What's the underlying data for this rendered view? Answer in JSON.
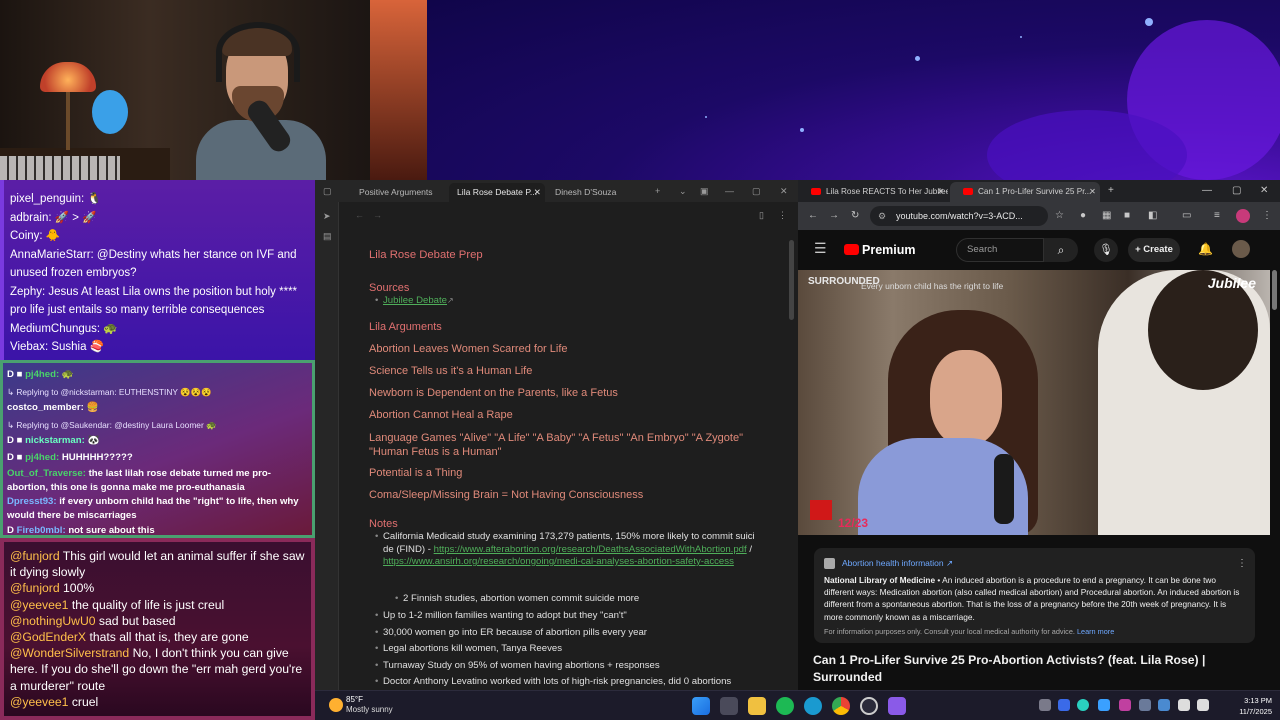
{
  "chat_top": {
    "messages": [
      "pixel_penguin: 🐧",
      "adbrain: 🚀 > 🚀",
      "Coiny: 🐥",
      "AnnaMarieStarr: @Destiny whats her stance on IVF and unused frozen embryos?",
      "Zephy: Jesus At least Lila owns the position but holy **** pro life just entails so many terrible consequences",
      "MediumChungus: 🐢",
      "Viebax: Sushia 🍣"
    ]
  },
  "chat_mid": {
    "messages": [
      {
        "user": "pj4hed:",
        "text": " 🐢",
        "kind": "sub",
        "badge": "D ■"
      },
      {
        "text": "↳ Replying to @nickstarman: EUTHENSTINY 😵😵😵",
        "kind": "reply"
      },
      {
        "user": "costco_member:",
        "text": " 🍔",
        "kind": "plain"
      },
      {
        "text": "↳ Replying to @Saukendar: @destiny Laura Loomer 🐢",
        "kind": "reply"
      },
      {
        "user": "nickstarman:",
        "text": " 🐼",
        "kind": "u2",
        "badge": "D ■"
      },
      {
        "user": "pj4hed:",
        "text": " HUHHHH?????",
        "kind": "sub",
        "badge": "D ■"
      },
      {
        "user": "Out_of_Traverse:",
        "text": " the last lilah rose debate turned me pro-abortion, this one is gonna make me pro-euthanasia",
        "kind": "wrap"
      },
      {
        "user": "Dpresst93:",
        "text": " if every unborn child had the \"right\" to life, then why would there be miscarriages",
        "kind": "wrap"
      },
      {
        "user": "Fireb0mbl:",
        "text": " not sure about this",
        "kind": "u2",
        "badge": "D"
      }
    ]
  },
  "chat_bottom": {
    "messages": [
      {
        "user": "@funjord",
        "text": " This girl would let an animal suffer if she saw it dying slowly"
      },
      {
        "user": "@funjord",
        "text": " 100%"
      },
      {
        "user": "@yeevee1",
        "text": " the quality of life is just creul"
      },
      {
        "user": "@nothingUwU0",
        "text": " sad but based"
      },
      {
        "user": "@GodEnderX",
        "text": " thats all that is, they are gone"
      },
      {
        "user": "@WonderSilverstrand",
        "text": " No, I don't think you can give here. If you do she'll go down the \"err mah gerd you're a murderer\" route"
      },
      {
        "user": "@yeevee1",
        "text": " cruel"
      }
    ]
  },
  "obsidian": {
    "tabs": [
      "Positive Arguments",
      "Lila Rose Debate P...",
      "Dinesh D'Souza"
    ],
    "title": "Lila Rose Debate Prep",
    "sources_heading": "Sources",
    "sources_link": "Jubilee Debate",
    "args_heading": "Lila Arguments",
    "args": [
      "Abortion Leaves Women Scarred for Life",
      "Science Tells us it's a Human Life",
      "Newborn is Dependent on the Parents, like a Fetus",
      "Abortion Cannot Heal a Rape",
      "Language Games \"Alive\" \"A Life\" \"A Baby\" \"A Fetus\" \"An Embryo\" \"A Zygote\" \"Human Fetus is a Human\"",
      "Potential is a Thing",
      "Coma/Sleep/Missing Brain = Not Having Consciousness"
    ],
    "notes_heading": "Notes",
    "note1_text": "California Medicaid study examining 173,279 patients, 150% more likely to commit suicide (FIND) - ",
    "note1_link1": "https://www.afterabortion.org/research/DeathsAssociatedWithAbortion.pdf",
    "note1_sep": " / ",
    "note1_link2": "https://www.ansirh.org/research/ongoing/medi-cal-analyses-abortion-safety-access",
    "note1_sub": "2 Finnish studies, abortion women commit suicide more",
    "notes": [
      "Up to 1-2 million families wanting to adopt but they \"can't\"",
      "30,000 women go into ER because of abortion pills every year",
      "Legal abortions kill women, Tanya Reeves",
      "Turnaway Study on 95% of women having abortions + responses",
      "Doctor Anthony Levatino worked with lots of high-risk pregnancies, did 0 abortions"
    ]
  },
  "browser": {
    "tabs": [
      "Lila Rose REACTS To Her Jubilee",
      "Can 1 Pro-Lifer Survive 25 Pr..."
    ],
    "url": "youtube.com/watch?v=3-ACD...",
    "premium": "Premium",
    "search_placeholder": "Search",
    "create": "Create",
    "video_brand": "SURROUNDED",
    "video_tagline": "Every unborn child has the right to life",
    "video_watermark": "Jubilee",
    "video_count": "12/23",
    "info_heading": "Abortion health information ↗",
    "info_source": "National Library of Medicine",
    "info_body": " • An induced abortion is a procedure to end a pregnancy. It can be done two different ways: Medication abortion (also called medical abortion) and Procedural abortion. An induced abortion is different from a spontaneous abortion. That is the loss of a pregnancy before the 20th week of pregnancy. It is more commonly known as a miscarriage.",
    "info_note": "For information purposes only. Consult your local medical authority for advice. ",
    "info_more": "Learn more",
    "video_title": "Can 1 Pro-Lifer Survive 25 Pro-Abortion Activists? (feat. Lila Rose) | Surrounded"
  },
  "taskbar": {
    "temp": "85°F",
    "condition": "Mostly sunny",
    "time": "3:13 PM",
    "date": "11/7/2025"
  },
  "colors": {
    "obsidian_heading": "#e07070",
    "link_green": "#4fae5a",
    "youtube_red": "#ff0000"
  }
}
